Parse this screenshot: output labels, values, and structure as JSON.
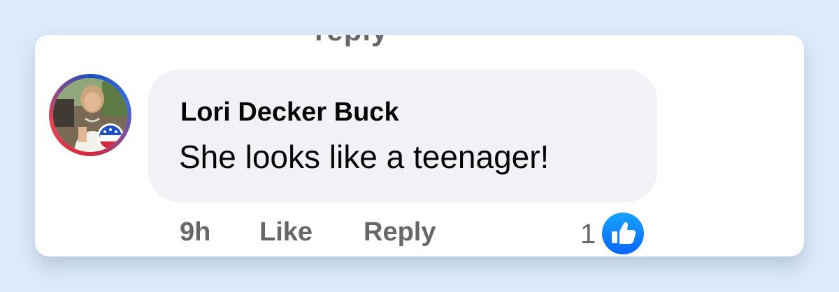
{
  "comment": {
    "above_cut_text": "reply",
    "author": "Lori Decker Buck",
    "text": "She looks like a teenager!",
    "timestamp": "9h",
    "like_label": "Like",
    "reply_label": "Reply",
    "reaction_count": "1"
  },
  "colors": {
    "background": "#dcebfa",
    "card": "#ffffff",
    "bubble": "#f0f2f5",
    "secondary_text": "#65676b",
    "primary_text": "#050505",
    "like_blue": "#0866ff"
  },
  "icons": {
    "reaction": "thumbs-up-icon",
    "avatar": "profile-photo-vote-frame"
  }
}
